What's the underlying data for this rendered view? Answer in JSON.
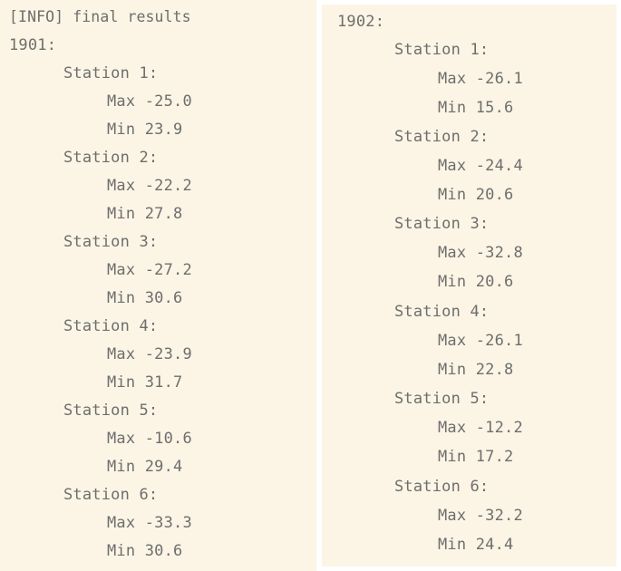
{
  "left_panel": {
    "header": "[INFO] final results",
    "year": "1901:",
    "stations": [
      {
        "label": "Station 1:",
        "max": "Max -25.0",
        "min": "Min 23.9"
      },
      {
        "label": "Station 2:",
        "max": "Max -22.2",
        "min": "Min 27.8"
      },
      {
        "label": "Station 3:",
        "max": "Max -27.2",
        "min": "Min 30.6"
      },
      {
        "label": "Station 4:",
        "max": "Max -23.9",
        "min": "Min 31.7"
      },
      {
        "label": "Station 5:",
        "max": "Max -10.6",
        "min": "Min 29.4"
      },
      {
        "label": "Station 6:",
        "max": "Max -33.3",
        "min": "Min 30.6"
      }
    ]
  },
  "right_panel": {
    "year": "1902:",
    "stations": [
      {
        "label": "Station 1:",
        "max": "Max -26.1",
        "min": "Min 15.6"
      },
      {
        "label": "Station 2:",
        "max": "Max -24.4",
        "min": "Min 20.6"
      },
      {
        "label": "Station 3:",
        "max": "Max -32.8",
        "min": "Min 20.6"
      },
      {
        "label": "Station 4:",
        "max": "Max -26.1",
        "min": "Min 22.8"
      },
      {
        "label": "Station 5:",
        "max": "Max -12.2",
        "min": "Min 17.2"
      },
      {
        "label": "Station 6:",
        "max": "Max -32.2",
        "min": "Min 24.4"
      }
    ]
  },
  "colors": {
    "panel_background": "#fcf5e5",
    "text": "#6e6e6e",
    "page_background": "#ffffff"
  }
}
